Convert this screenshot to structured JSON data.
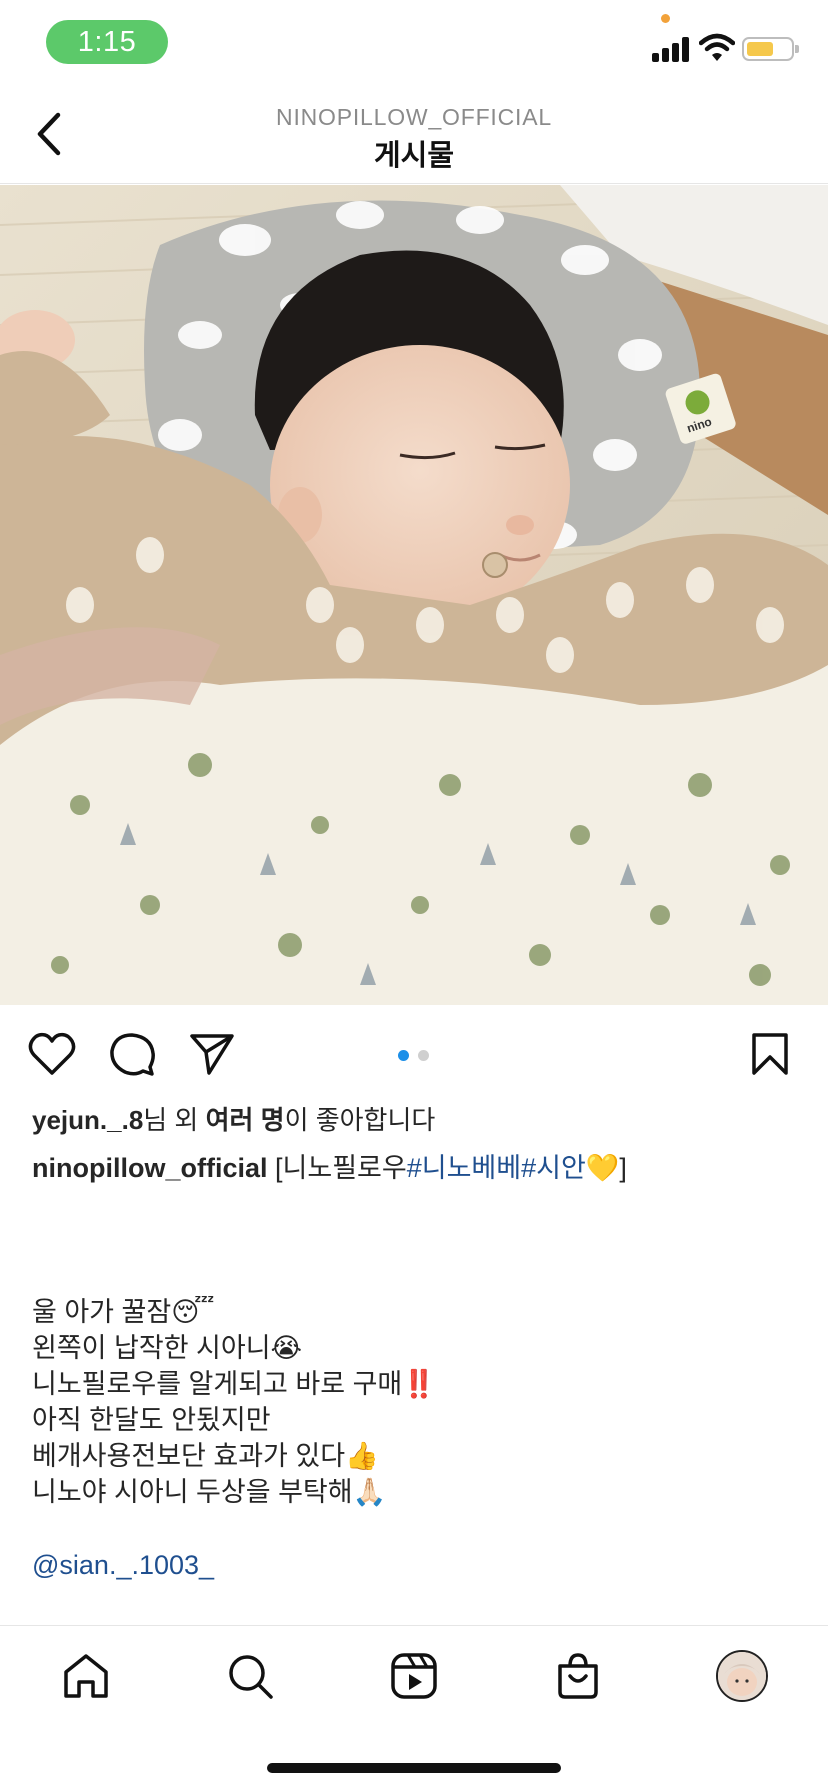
{
  "status_bar": {
    "time": "1:15",
    "signal_icon": "cellular-signal-icon",
    "wifi_icon": "wifi-icon",
    "battery_icon": "battery-icon",
    "battery_level": 0.55,
    "colors": {
      "time_pill": "#5cc96a",
      "battery_fill": "#f5c84c",
      "privacy_dot": "#f2a23a"
    }
  },
  "header": {
    "account": "NINOPILLOW_OFFICIAL",
    "title": "게시물",
    "back_icon": "chevron-left-icon"
  },
  "post": {
    "image_alt": "sleeping baby on a grey cloud-pattern nino pillow",
    "carousel": {
      "total": 2,
      "active": 1,
      "active_color": "#1c8fe8",
      "inactive_color": "#cfcfcf"
    },
    "actions": {
      "like_icon": "heart-icon",
      "comment_icon": "comment-bubble-icon",
      "share_icon": "paper-plane-icon",
      "save_icon": "bookmark-icon"
    },
    "likes": {
      "user": "yejun._.8",
      "mid": "님 외 ",
      "bold": "여러 명",
      "tail": "이 좋아합니다"
    },
    "caption": {
      "user": "ninopillow_official",
      "open": "[니노필로우",
      "tags": "#니노베베#시안",
      "close_emoji": "💛",
      "close": "]",
      "lines": [
        "울 아가 꿀잠😴",
        "왼쪽이 납작한 시아니😭",
        "니노필로우를 알게되고 바로 구매‼️",
        "아직 한달도 안됬지만",
        "베개사용전보단 효과가 있다👍",
        "니노야 시아니 두상을 부탁해🙏🏻"
      ],
      "mention": "@sian._.1003_"
    }
  },
  "tab_bar": {
    "items": [
      {
        "name": "home",
        "icon": "home-icon"
      },
      {
        "name": "search",
        "icon": "search-icon"
      },
      {
        "name": "reels",
        "icon": "reels-icon"
      },
      {
        "name": "shop",
        "icon": "shopping-bag-icon"
      },
      {
        "name": "profile",
        "icon": "profile-avatar"
      }
    ]
  },
  "colors": {
    "link": "#1f4f8f",
    "text": "#262626",
    "secondary": "#8a8a8a"
  }
}
